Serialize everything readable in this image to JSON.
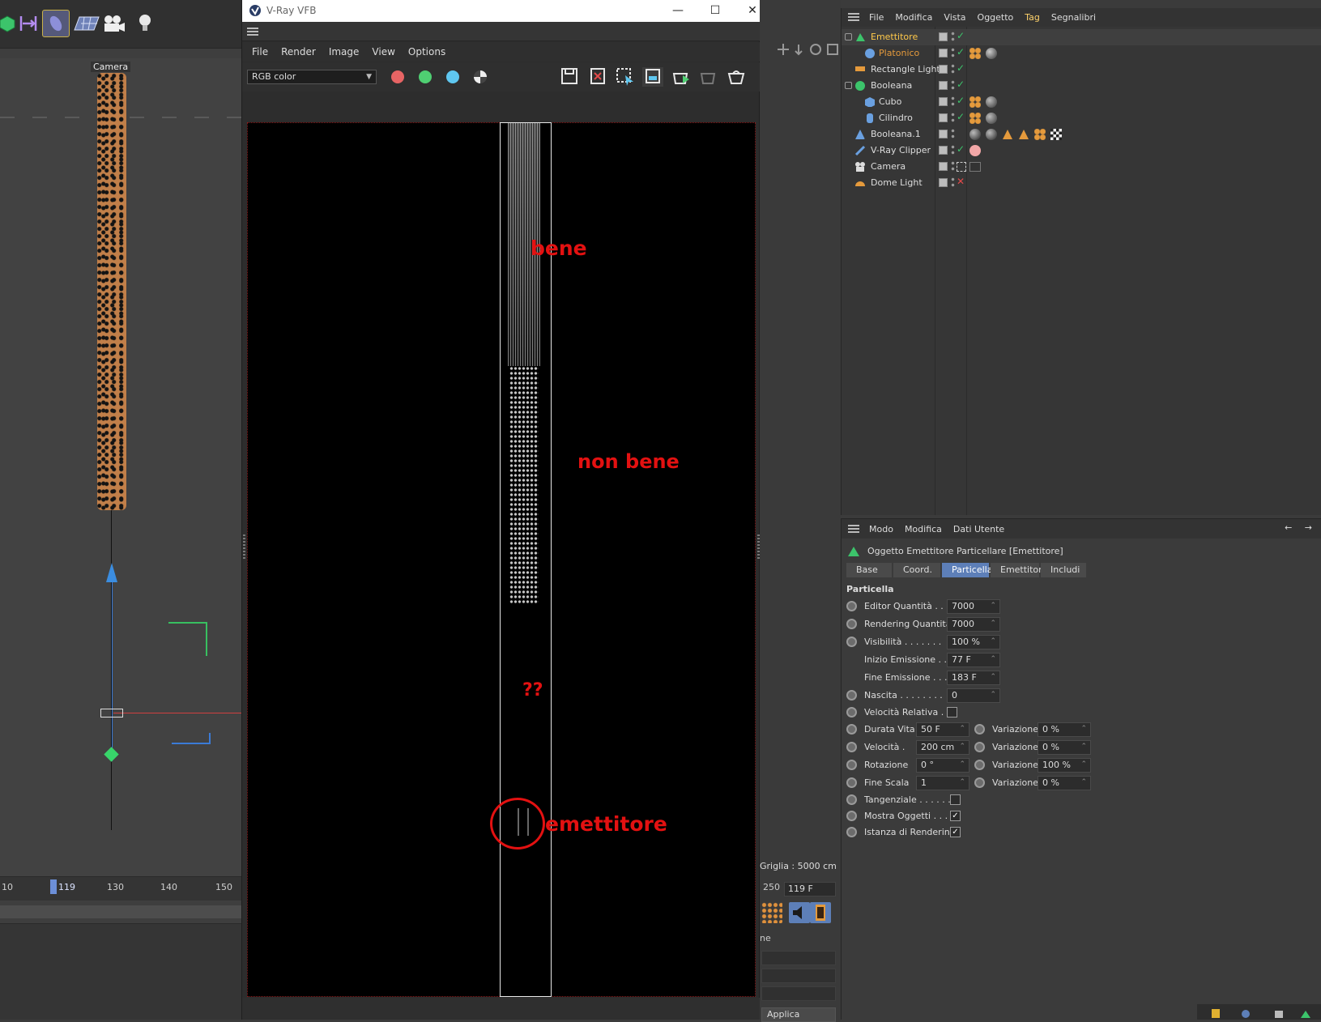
{
  "viewport": {
    "camera_label": "Camera",
    "timeline_ticks": [
      "10",
      "119",
      "130",
      "140",
      "150"
    ]
  },
  "vfb": {
    "title": "V-Ray VFB",
    "window_buttons": {
      "minimize": "—",
      "maximize": "☐",
      "close": "✕"
    },
    "menu": [
      "File",
      "Render",
      "Image",
      "View",
      "Options"
    ],
    "channel": "RGB color",
    "annotations": {
      "good": "bene",
      "not_good": "non bene",
      "question": "??",
      "emitter": "emettitore"
    },
    "colors": {
      "red": "#e76464",
      "green": "#4fcf72",
      "blue": "#5fc7f0",
      "annotation": "#e31111"
    }
  },
  "middle": {
    "grid_label": "Griglia : 5000 cm",
    "frame_prefix": "250",
    "frame_value": "119 F",
    "label_ne": "ne",
    "apply_label": "Applica"
  },
  "object_manager": {
    "menu": [
      "File",
      "Modifica",
      "Vista",
      "Oggetto",
      "Tag",
      "Segnalibri"
    ],
    "objects": [
      {
        "name": "Emettitore",
        "color": "#ffc94a"
      },
      {
        "name": "Platonico",
        "color": "#e59a3c"
      },
      {
        "name": "Rectangle Light",
        "color": "#dddddd"
      },
      {
        "name": "Booleana",
        "color": "#dddddd"
      },
      {
        "name": "Cubo",
        "color": "#dddddd"
      },
      {
        "name": "Cilindro",
        "color": "#dddddd"
      },
      {
        "name": "Booleana.1",
        "color": "#dddddd"
      },
      {
        "name": "V-Ray Clipper",
        "color": "#dddddd"
      },
      {
        "name": "Camera",
        "color": "#dddddd"
      },
      {
        "name": "Dome Light",
        "color": "#dddddd"
      }
    ]
  },
  "attribute_manager": {
    "menu": [
      "Modo",
      "Modifica",
      "Dati Utente"
    ],
    "title": "Oggetto Emettitore Particellare [Emettitore]",
    "tabs": [
      "Base",
      "Coord.",
      "Particella",
      "Emettitore",
      "Includi"
    ],
    "active_tab": "Particella",
    "section": "Particella",
    "params": {
      "editor_quantita": {
        "label": "Editor Quantità . .",
        "value": "7000"
      },
      "rendering_quantita": {
        "label": "Rendering Quantità",
        "value": "7000"
      },
      "visibilita": {
        "label": "Visibilità . . . . . . .",
        "value": "100 %"
      },
      "inizio_emissione": {
        "label": "Inizio Emissione . .",
        "value": "77 F"
      },
      "fine_emissione": {
        "label": "Fine Emissione . . .",
        "value": "183 F"
      },
      "nascita": {
        "label": "Nascita . . . . . . . .",
        "value": "0"
      },
      "velocita_relativa": {
        "label": "Velocità Relativa . .",
        "checked": false
      },
      "durata_vita": {
        "label": "Durata Vita",
        "value": "50 F",
        "var_label": "Variazione",
        "var_value": "0 %"
      },
      "velocita": {
        "label": "Velocità  .",
        "value": "200 cm",
        "var_label": "Variazione",
        "var_value": "0 %"
      },
      "rotazione": {
        "label": "Rotazione",
        "value": "0 °",
        "var_label": "Variazione",
        "var_value": "100 %"
      },
      "fine_scala": {
        "label": "Fine Scala",
        "value": "1",
        "var_label": "Variazione",
        "var_value": "0 %"
      },
      "tangenziale": {
        "label": "Tangenziale . . . . . .",
        "checked": false
      },
      "mostra_oggetti": {
        "label": "Mostra Oggetti . . .",
        "checked": true
      },
      "istanza_rendering": {
        "label": "Istanza di Rendering",
        "checked": true
      }
    }
  }
}
